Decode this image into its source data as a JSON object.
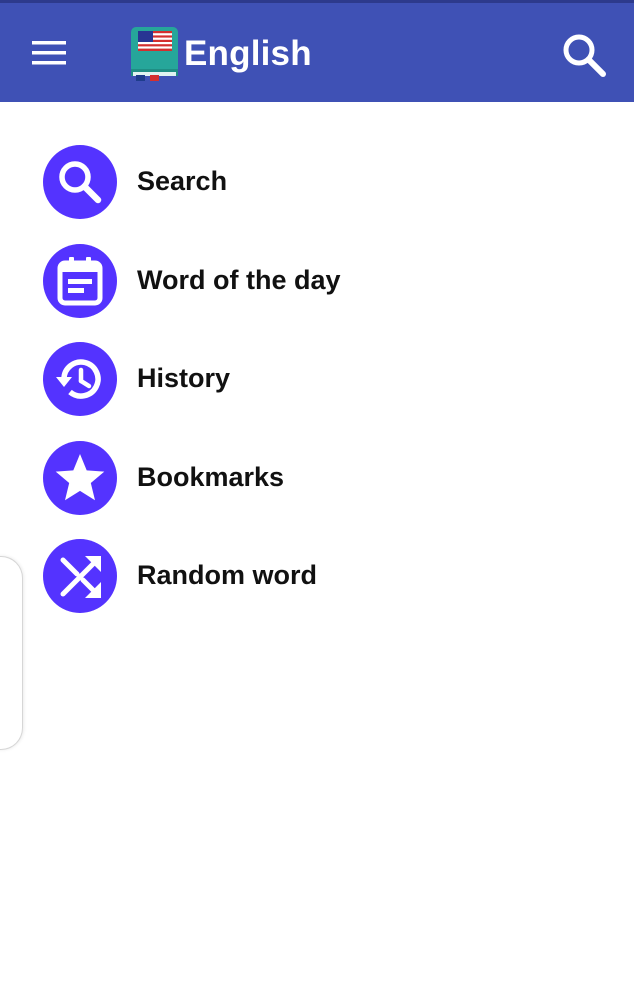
{
  "app": {
    "title": "English",
    "icons": {
      "menu": "hamburger-menu-icon",
      "logo": "us-flag-dictionary-logo",
      "search": "search-icon"
    },
    "colors": {
      "appbar": "#3f51b5",
      "accent": "#5433ff",
      "text": "#111111",
      "background": "#ffffff"
    }
  },
  "menu": {
    "items": [
      {
        "label": "Search",
        "icon": "search-icon"
      },
      {
        "label": "Word of the day",
        "icon": "calendar-note-icon"
      },
      {
        "label": "History",
        "icon": "history-icon"
      },
      {
        "label": "Bookmarks",
        "icon": "star-icon"
      },
      {
        "label": "Random word",
        "icon": "shuffle-icon"
      }
    ]
  }
}
